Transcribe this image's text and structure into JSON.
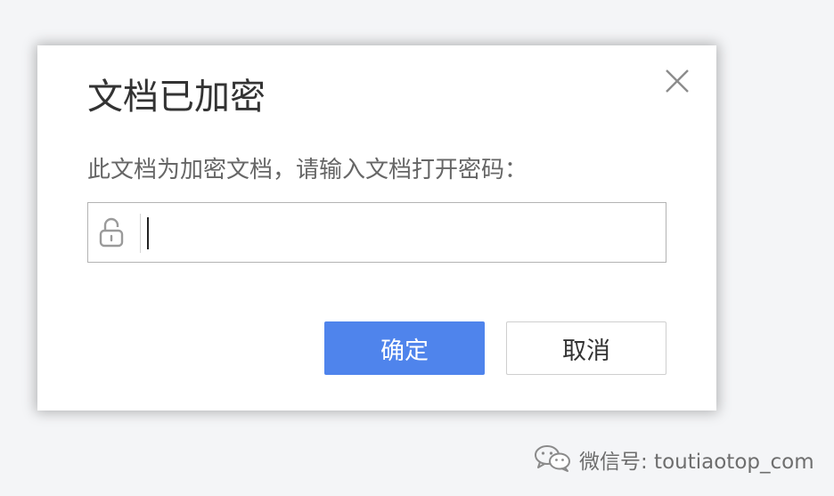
{
  "dialog": {
    "title": "文档已加密",
    "prompt": "此文档为加密文档，请输入文档打开密码：",
    "password_value": "",
    "ok_label": "确定",
    "cancel_label": "取消"
  },
  "icons": {
    "close": "close-icon",
    "lock": "lock-icon",
    "wechat": "wechat-icon"
  },
  "watermark": {
    "text": "微信号: toutiaotop_com"
  },
  "colors": {
    "accent": "#4f84ec",
    "background": "#f4f5f7",
    "dialog_background": "#ffffff"
  }
}
